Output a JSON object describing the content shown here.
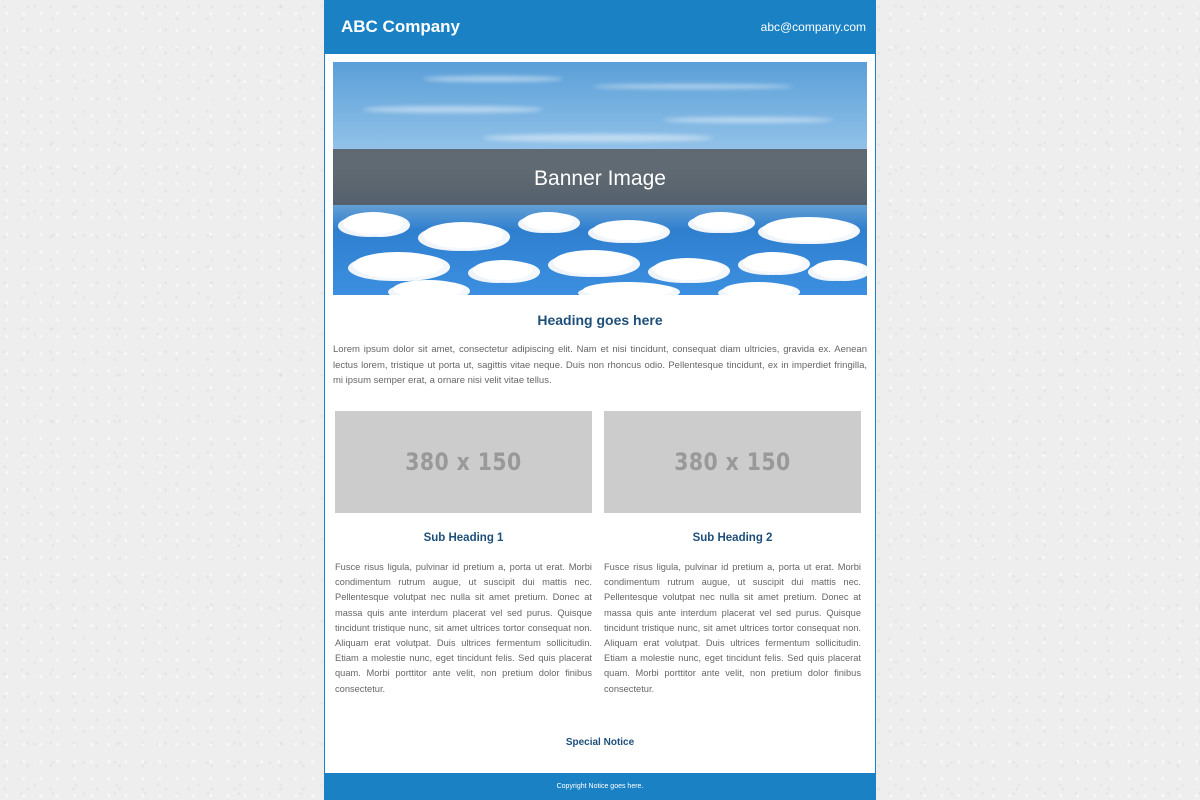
{
  "header": {
    "company": "ABC Company",
    "email": "abc@company.com"
  },
  "banner": {
    "label": "Banner Image"
  },
  "main": {
    "heading": "Heading goes here",
    "intro": "Lorem ipsum dolor sit amet, consectetur adipiscing elit. Nam et nisi tincidunt, consequat diam ultricies, gravida ex. Aenean lectus lorem, tristique ut porta ut, sagittis vitae neque. Duis non rhoncus odio. Pellentesque tincidunt, ex in imperdiet fringilla, mi ipsum semper erat, a ornare nisi velit vitae tellus."
  },
  "columns": [
    {
      "placeholder": "380 x 150",
      "heading": "Sub Heading 1",
      "text": "Fusce risus ligula, pulvinar id pretium a, porta ut erat. Morbi condimentum rutrum augue, ut suscipit dui mattis nec. Pellentesque volutpat nec nulla sit amet pretium. Donec at massa quis ante interdum placerat vel sed purus. Quisque tincidunt tristique nunc, sit amet ultrices tortor consequat non. Aliquam erat volutpat. Duis ultrices fermentum sollicitudin. Etiam a molestie nunc, eget tincidunt felis. Sed quis placerat quam. Morbi porttitor ante velit, non pretium dolor finibus consectetur."
    },
    {
      "placeholder": "380 x 150",
      "heading": "Sub Heading 2",
      "text": "Fusce risus ligula, pulvinar id pretium a, porta ut erat. Morbi condimentum rutrum augue, ut suscipit dui mattis nec. Pellentesque volutpat nec nulla sit amet pretium. Donec at massa quis ante interdum placerat vel sed purus. Quisque tincidunt tristique nunc, sit amet ultrices tortor consequat non. Aliquam erat volutpat. Duis ultrices fermentum sollicitudin. Etiam a molestie nunc, eget tincidunt felis. Sed quis placerat quam. Morbi porttitor ante velit, non pretium dolor finibus consectetur."
    }
  ],
  "special_notice": "Special Notice",
  "footer": {
    "copyright": "Copyright Notice goes here."
  },
  "colors": {
    "brand_blue": "#1a82c4",
    "heading_navy": "#1e4f7a",
    "placeholder_gray": "#cccccc",
    "body_text": "#666666"
  }
}
